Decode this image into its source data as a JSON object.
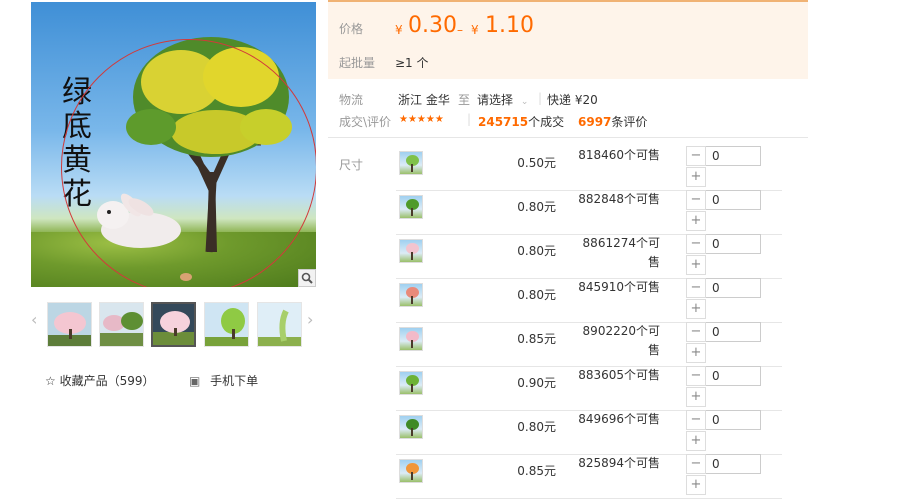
{
  "gallery": {
    "caption": "绿底黄花",
    "thumbnails": [
      {
        "color": "#f4c6d1"
      },
      {
        "color": "#e7b9c7"
      },
      {
        "color": "#f6d2dc"
      },
      {
        "color": "#8fca44"
      },
      {
        "color": "#a8cf6a"
      }
    ],
    "prev_arrow": "‹",
    "next_arrow": "›"
  },
  "actions": {
    "collect_icon": "☆",
    "collect_label": "收藏产品（599）",
    "mobile_icon": "▣",
    "mobile_label": "手机下单"
  },
  "price": {
    "label": "价格",
    "currency": "¥",
    "low": "0.30",
    "separator": "–",
    "high": "1.10"
  },
  "moq": {
    "label": "起批量",
    "value": "≥1 个"
  },
  "logistics": {
    "label": "物流",
    "from": "浙江 金华",
    "to_word": "至",
    "select": "请选择",
    "express": "快递 ¥20"
  },
  "deal": {
    "label": "成交\\评价",
    "stars": "★★★★★",
    "count": "245715",
    "count_unit": "个成交",
    "reviews": "6997",
    "reviews_unit": "条评价"
  },
  "sku": {
    "label": "尺寸",
    "minus": "−",
    "plus": "+",
    "rows": [
      {
        "price": "0.50元",
        "stock": "818460个可售",
        "qty": "0",
        "color": "#7fc14a"
      },
      {
        "price": "0.80元",
        "stock": "882848个可售",
        "qty": "0",
        "color": "#4f9a2a"
      },
      {
        "price": "0.80元",
        "stock": "8861274个可售",
        "qty": "0",
        "color": "#f2c4cf"
      },
      {
        "price": "0.80元",
        "stock": "845910个可售",
        "qty": "0",
        "color": "#e98a7a"
      },
      {
        "price": "0.85元",
        "stock": "8902220个可售",
        "qty": "0",
        "color": "#f3bac9"
      },
      {
        "price": "0.90元",
        "stock": "883605个可售",
        "qty": "0",
        "color": "#6cb236"
      },
      {
        "price": "0.80元",
        "stock": "849696个可售",
        "qty": "0",
        "color": "#3f8a25"
      },
      {
        "price": "0.85元",
        "stock": "825894个可售",
        "qty": "0",
        "color": "#f0963a"
      }
    ]
  }
}
